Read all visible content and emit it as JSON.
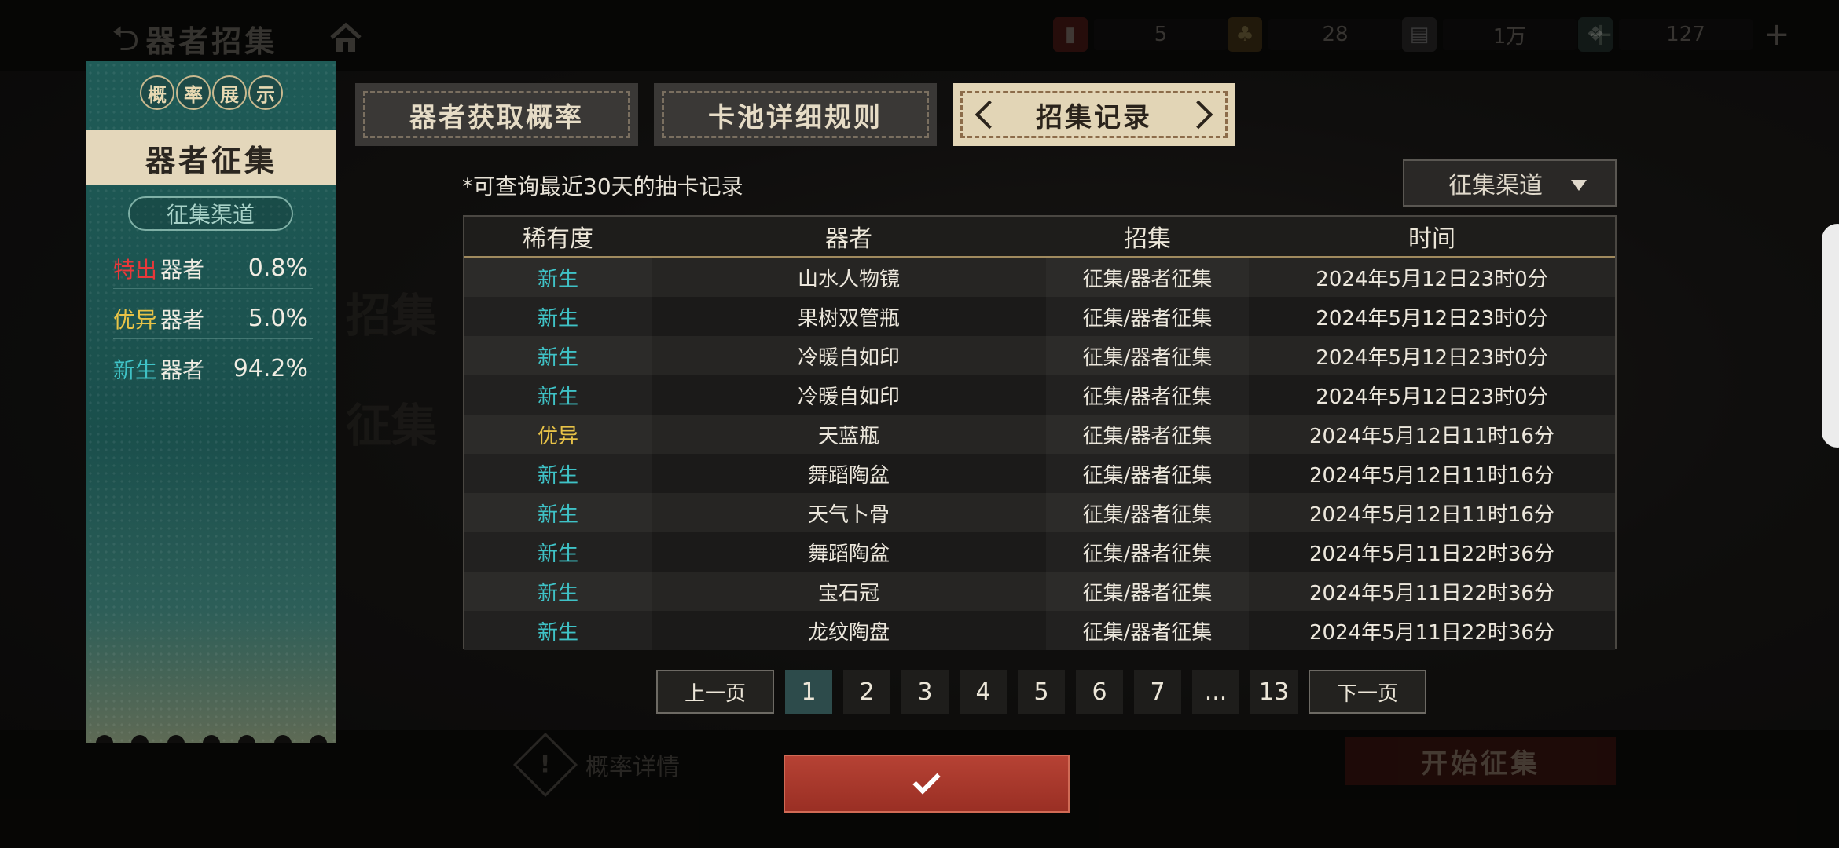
{
  "header": {
    "title": "器者招集",
    "resources": [
      {
        "icon": "red-ticket-icon",
        "value": "5",
        "plus": false
      },
      {
        "icon": "gold-pouch-icon",
        "value": "28",
        "plus": false
      },
      {
        "icon": "scroll-icon",
        "value": "1万",
        "plus": true
      },
      {
        "icon": "jade-token-icon",
        "value": "127",
        "plus": true
      }
    ]
  },
  "left_panel": {
    "chars": [
      "概",
      "率",
      "展",
      "示"
    ],
    "banner": "器者征集",
    "channel": "征集渠道",
    "rates": [
      {
        "rarity": "特出",
        "kind": "器者",
        "pct": "0.8%",
        "color": "#e8383a"
      },
      {
        "rarity": "优异",
        "kind": "器者",
        "pct": "5.0%",
        "color": "#e8c347"
      },
      {
        "rarity": "新生",
        "kind": "器者",
        "pct": "94.2%",
        "color": "#3fc2c6"
      }
    ]
  },
  "tabs": [
    {
      "label": "器者获取概率",
      "active": false
    },
    {
      "label": "卡池详细规则",
      "active": false
    },
    {
      "label": "招集记录",
      "active": true
    }
  ],
  "records": {
    "note": "*可查询最近30天的抽卡记录",
    "filter_label": "征集渠道",
    "columns": [
      "稀有度",
      "器者",
      "招集",
      "时间"
    ],
    "rows": [
      {
        "rarity": "新生",
        "name": "山水人物镜",
        "source": "征集/器者征集",
        "time": "2024年5月12日23时0分"
      },
      {
        "rarity": "新生",
        "name": "果树双管瓶",
        "source": "征集/器者征集",
        "time": "2024年5月12日23时0分"
      },
      {
        "rarity": "新生",
        "name": "冷暖自如印",
        "source": "征集/器者征集",
        "time": "2024年5月12日23时0分"
      },
      {
        "rarity": "新生",
        "name": "冷暖自如印",
        "source": "征集/器者征集",
        "time": "2024年5月12日23时0分"
      },
      {
        "rarity": "优异",
        "name": "天蓝瓶",
        "source": "征集/器者征集",
        "time": "2024年5月12日11时16分"
      },
      {
        "rarity": "新生",
        "name": "舞蹈陶盆",
        "source": "征集/器者征集",
        "time": "2024年5月12日11时16分"
      },
      {
        "rarity": "新生",
        "name": "天气卜骨",
        "source": "征集/器者征集",
        "time": "2024年5月12日11时16分"
      },
      {
        "rarity": "新生",
        "name": "舞蹈陶盆",
        "source": "征集/器者征集",
        "time": "2024年5月11日22时36分"
      },
      {
        "rarity": "新生",
        "name": "宝石冠",
        "source": "征集/器者征集",
        "time": "2024年5月11日22时36分"
      },
      {
        "rarity": "新生",
        "name": "龙纹陶盘",
        "source": "征集/器者征集",
        "time": "2024年5月11日22时36分"
      }
    ]
  },
  "pagination": {
    "prev": "上一页",
    "next": "下一页",
    "pages": [
      "1",
      "2",
      "3",
      "4",
      "5",
      "6",
      "7",
      "...",
      "13"
    ],
    "current": "1"
  },
  "background": {
    "prob_detail": "概率详情",
    "prob_icon_glyph": "!",
    "start_button": "开始征集",
    "ghost_text": [
      "招集",
      "征集"
    ]
  }
}
